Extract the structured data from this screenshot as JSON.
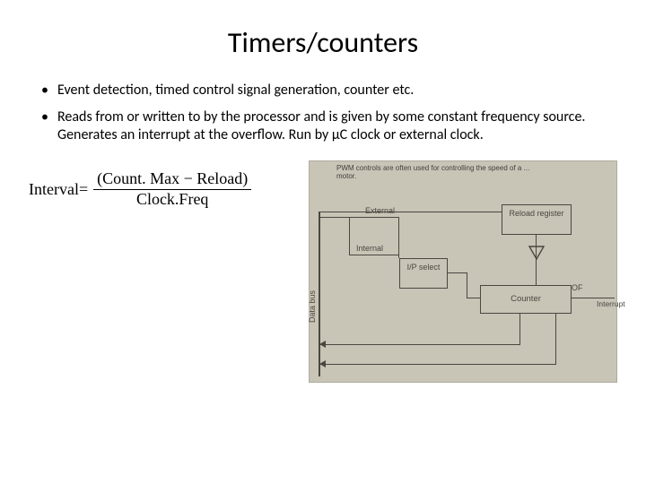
{
  "title": "Timers/counters",
  "bullets": [
    "Event detection, timed control signal generation, counter etc.",
    "Reads from or written to by the processor and is given by some constant frequency source. Generates an interrupt at the overflow. Run by μC clock or external clock."
  ],
  "formula": {
    "lhs": "Interval=",
    "numerator": "(Count. Max − Reload)",
    "denominator": "Clock.Freq"
  },
  "diagram": {
    "caption_fragment": "PWM controls are often used for controlling the speed of a ...",
    "caption_prefix": "motor.",
    "data_bus": "Data bus",
    "external": "External",
    "internal": "Internal",
    "ip_select": "I/P select",
    "reload_register": "Reload register",
    "counter": "Counter",
    "of": "OF",
    "interrupt": "Interrupt"
  }
}
